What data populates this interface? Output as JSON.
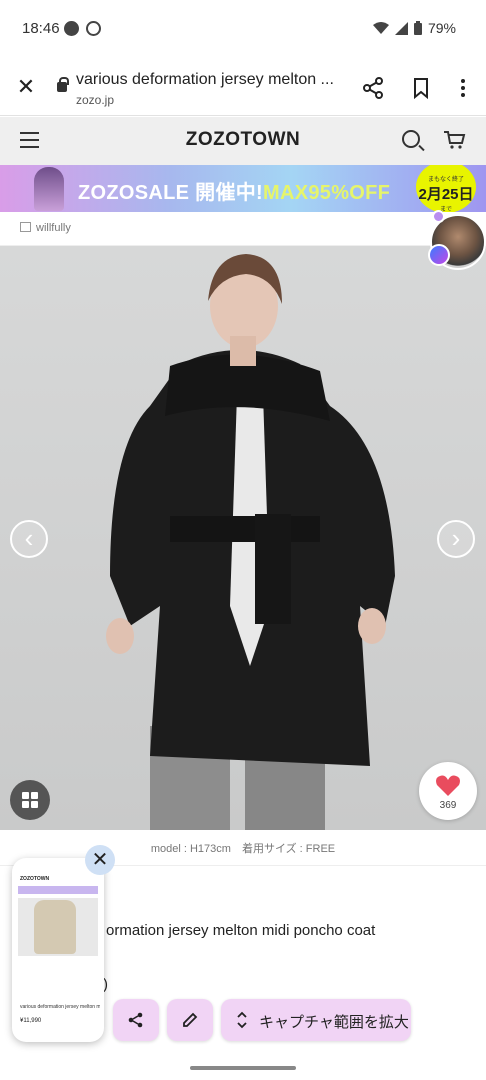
{
  "status_bar": {
    "time": "18:46",
    "battery": "79%"
  },
  "browser": {
    "page_title": "various deformation jersey melton ...",
    "url": "zozo.jp"
  },
  "site_header": {
    "logo": "ZOZOTOWN"
  },
  "banner": {
    "text_main": "ZOZOSALE 開催中!",
    "text_max": "MAX95%OFF",
    "badge_small": "まもなく終了",
    "badge_date": "2月25日",
    "badge_sub": "まで"
  },
  "brand": {
    "name": "willfully"
  },
  "product": {
    "like_count": "369",
    "model_caption": "model : H173cm　着用サイズ : FREE",
    "title_visible": "ormation jersey melton midi poncho coat",
    "price_stub": ")"
  },
  "capture_thumbnail": {
    "header": "ZOZOTOWN",
    "line": "various deformation jersey melton midi poncho coat",
    "price": "¥11,990"
  },
  "capture_actions": {
    "expand_label": "キャプチャ範囲を拡大"
  },
  "colors": {
    "capture_button_bg": "#f1d4f5",
    "banner_yellow": "#e8f400",
    "like_heart": "#e94c5e"
  }
}
